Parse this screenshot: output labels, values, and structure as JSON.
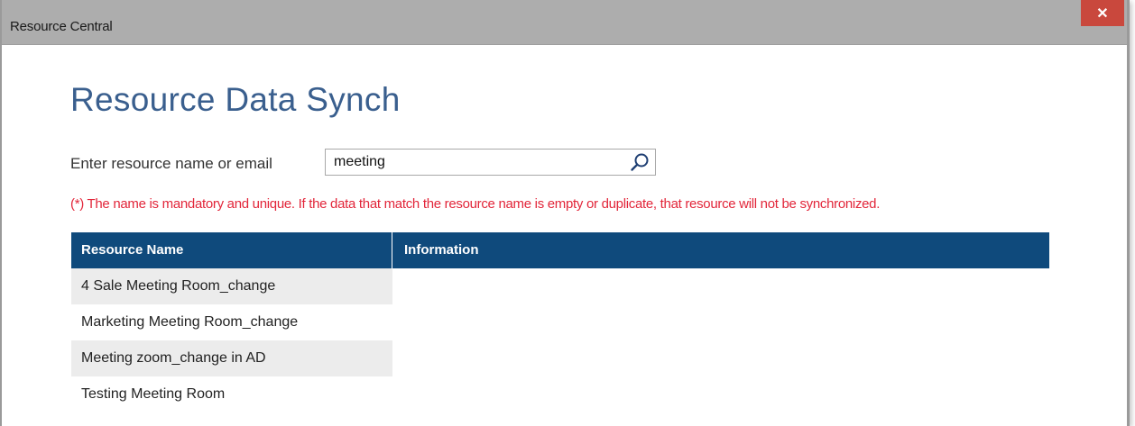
{
  "window": {
    "title": "Resource Central",
    "close_symbol": "✕"
  },
  "page": {
    "heading": "Resource Data Synch",
    "search_label": "Enter resource name or email",
    "search_value": "meeting",
    "search_icon": "magnifier-icon",
    "note": "(*) The name is mandatory and unique. If the data that match the resource name is empty or duplicate, that resource will not be synchronized."
  },
  "table": {
    "columns": [
      "Resource Name",
      "Information"
    ],
    "rows": [
      "4 Sale Meeting Room_change",
      "Marketing Meeting Room_change",
      "Meeting zoom_change in AD",
      "Testing Meeting Room"
    ]
  },
  "colors": {
    "accent": "#3a5f8e",
    "header_bg": "#0f4a7c",
    "warning": "#e2263a",
    "close_bg": "#c9483d"
  }
}
